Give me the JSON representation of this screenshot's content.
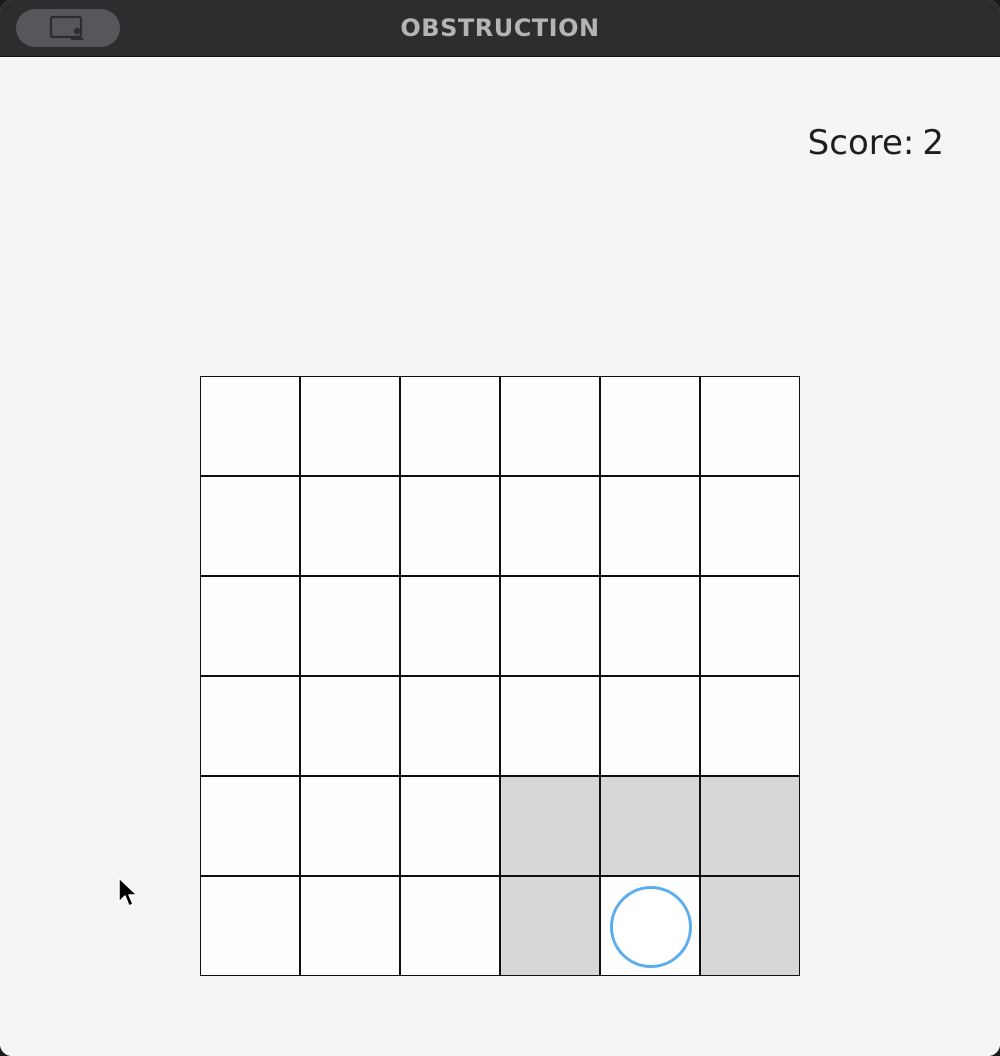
{
  "window": {
    "title": "OBSTRUCTION"
  },
  "score": {
    "label": "Score:",
    "value": "2"
  },
  "board": {
    "rows": 6,
    "cols": 6,
    "cells": [
      [
        "empty",
        "empty",
        "empty",
        "empty",
        "empty",
        "empty"
      ],
      [
        "empty",
        "empty",
        "empty",
        "empty",
        "empty",
        "empty"
      ],
      [
        "empty",
        "empty",
        "empty",
        "empty",
        "empty",
        "empty"
      ],
      [
        "empty",
        "empty",
        "empty",
        "empty",
        "empty",
        "empty"
      ],
      [
        "empty",
        "empty",
        "empty",
        "blocked",
        "blocked",
        "blocked"
      ],
      [
        "empty",
        "empty",
        "empty",
        "blocked",
        "piece-o",
        "blocked"
      ]
    ],
    "piece_color": "#5aaef0",
    "blocked_color": "#d7d7d7"
  },
  "icons": {
    "titlebar_button": "picture-in-picture-person-icon",
    "cursor": "mouse-pointer-icon"
  }
}
